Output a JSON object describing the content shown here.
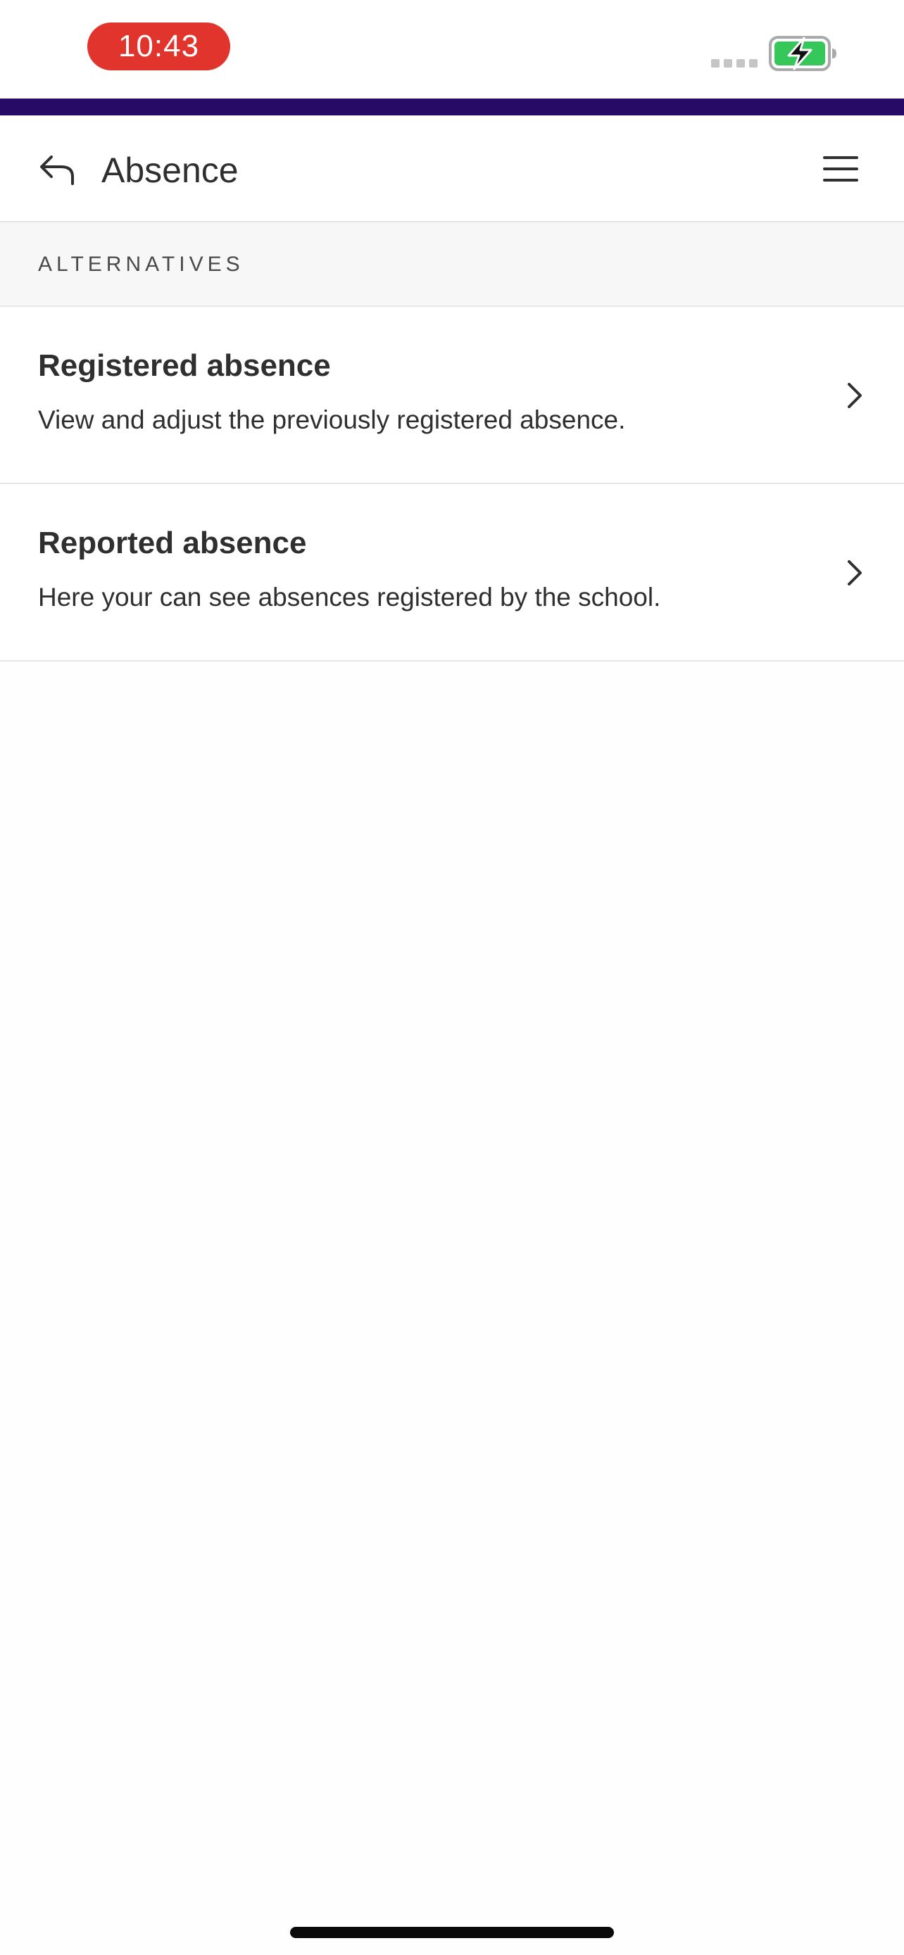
{
  "status_bar": {
    "time": "10:43",
    "time_pill_color": "#e0342d",
    "battery_color": "#35c759",
    "battery_state": "charging"
  },
  "accent_color": "#260a66",
  "nav": {
    "title": "Absence",
    "back_icon": "back-arrow-icon",
    "menu_icon": "hamburger-menu-icon"
  },
  "section": {
    "label": "ALTERNATIVES"
  },
  "items": [
    {
      "title": "Registered absence",
      "description": "View and adjust the previously registered absence.",
      "icon": "chevron-right-icon"
    },
    {
      "title": "Reported absence",
      "description": "Here your can see absences registered by the school.",
      "icon": "chevron-right-icon"
    }
  ]
}
